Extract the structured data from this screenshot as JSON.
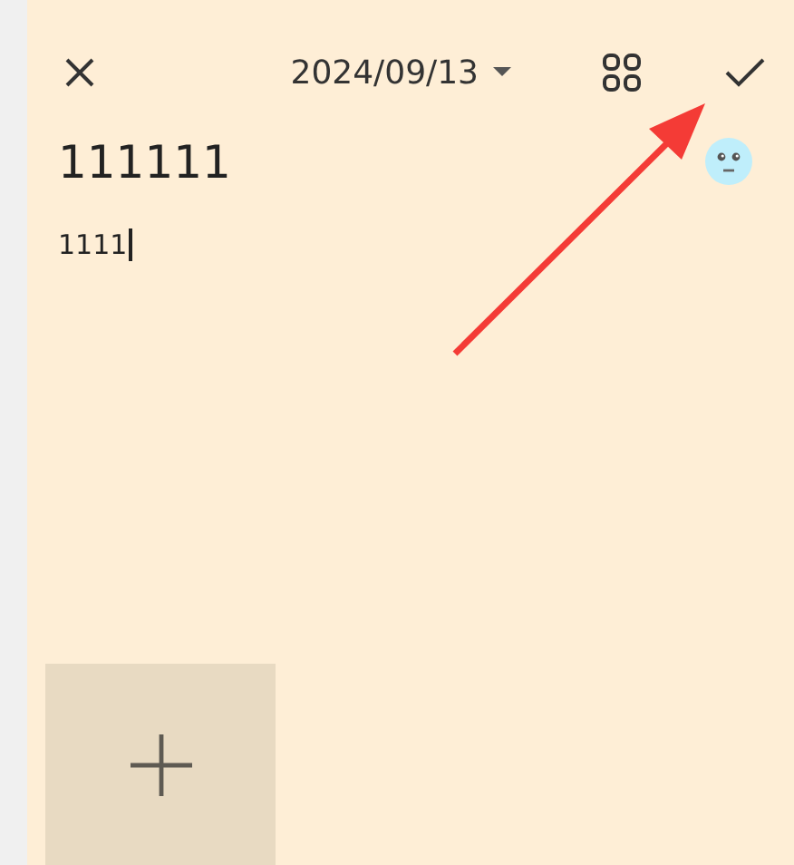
{
  "toolbar": {
    "date": "2024/09/13"
  },
  "note": {
    "title": "111111",
    "body": "1111",
    "cursor": true
  },
  "attachments": {
    "add_tile": true
  },
  "annotation": {
    "kind": "arrow",
    "color": "#f43b36"
  }
}
